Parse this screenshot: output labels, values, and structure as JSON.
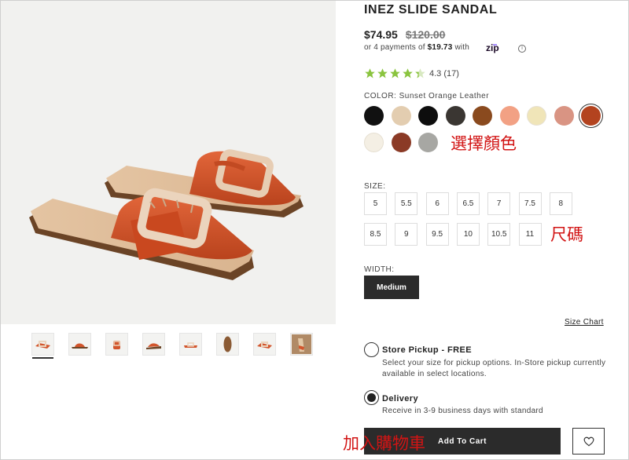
{
  "product": {
    "title": "INEZ SLIDE SANDAL",
    "price": "$74.95",
    "original_price": "$120.00",
    "installments_prefix": "or 4 payments of",
    "installment_amount": "$19.73",
    "installments_suffix": "with",
    "zip_brand": "zip",
    "rating_value": 4.3,
    "rating_text": "4.3 (17)"
  },
  "color": {
    "label": "COLOR: Sunset Orange Leather",
    "annotation": "選擇顏色",
    "swatches": [
      {
        "name": "Black",
        "hex": "#111111",
        "selected": false
      },
      {
        "name": "Beige",
        "hex": "#e3cdb0",
        "selected": false
      },
      {
        "name": "Black Leather",
        "hex": "#0d0d0d",
        "selected": false
      },
      {
        "name": "Black Pattern",
        "hex": "#3a3632",
        "selected": false
      },
      {
        "name": "Cognac",
        "hex": "#8a4a1e",
        "selected": false
      },
      {
        "name": "Coral",
        "hex": "#f2a184",
        "selected": false
      },
      {
        "name": "Cream",
        "hex": "#f0e5b8",
        "selected": false
      },
      {
        "name": "Rose",
        "hex": "#d99483",
        "selected": false
      },
      {
        "name": "Sunset Orange Leather",
        "hex": "#b3431f",
        "selected": true
      },
      {
        "name": "Ivory",
        "hex": "#f4efe4",
        "selected": false
      },
      {
        "name": "Brown",
        "hex": "#8b3a26",
        "selected": false
      },
      {
        "name": "Grey",
        "hex": "#a7a7a3",
        "selected": false
      }
    ]
  },
  "size": {
    "label": "SIZE:",
    "annotation": "尺碼",
    "options": [
      "5",
      "5.5",
      "6",
      "6.5",
      "7",
      "7.5",
      "8",
      "8.5",
      "9",
      "9.5",
      "10",
      "10.5",
      "11"
    ]
  },
  "width": {
    "label": "WIDTH:",
    "selected": "Medium"
  },
  "size_chart": "Size Chart",
  "fulfillment": {
    "pickup": {
      "title": "Store Pickup - FREE",
      "desc": "Select your size for pickup options. In-Store pickup currently available in select locations.",
      "selected": false
    },
    "delivery": {
      "title": "Delivery",
      "desc": "Receive in 3-9 business days with standard",
      "selected": true
    }
  },
  "cart": {
    "button": "Add To Cart",
    "annotation": "加入購物車"
  },
  "colors": {
    "accent_dark": "#2b2b2b",
    "star_green": "#8ac43f",
    "annotation_red": "#d21414",
    "sandal_orange": "#d2552c"
  }
}
